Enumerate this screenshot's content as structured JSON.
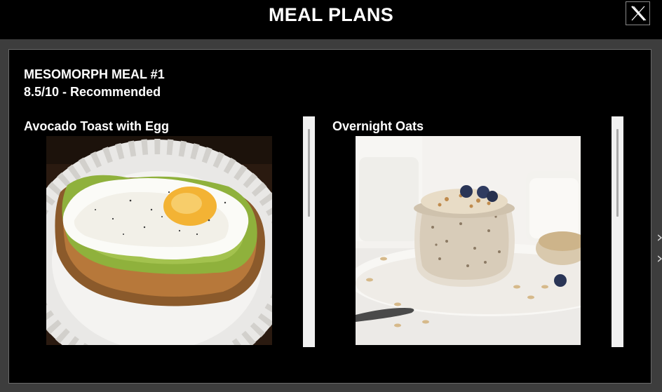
{
  "window": {
    "title": "MEAL PLANS",
    "close_icon": "x-close-icon"
  },
  "meal": {
    "title": "MESOMORPH MEAL #1",
    "rating": "8.5/10 - Recommended"
  },
  "cards": [
    {
      "label": "Avocado Toast with Egg",
      "image": "avocado-toast-egg-photo"
    },
    {
      "label": "Overnight Oats",
      "image": "overnight-oats-photo"
    }
  ],
  "colors": {
    "background": "#000000",
    "frame": "#3d3d3d",
    "text": "#ffffff",
    "scrollbar_track": "#f1f1f1"
  }
}
